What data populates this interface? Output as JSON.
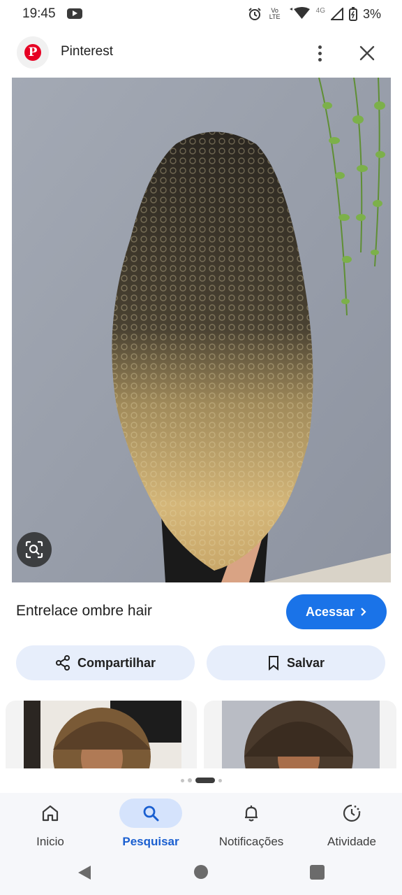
{
  "status_bar": {
    "time": "19:45",
    "network": "4G",
    "volte": "Vo LTE",
    "battery": "3%"
  },
  "header": {
    "app_title": "Pinterest",
    "logo_letter": "P"
  },
  "pin": {
    "title": "Entrelace ombre hair",
    "visit_label": "Acessar",
    "share_label": "Compartilhar",
    "save_label": "Salvar"
  },
  "pager": {
    "count": 4,
    "active_index": 2
  },
  "bottom_nav": {
    "items": [
      {
        "label": "Inicio",
        "icon": "home-icon"
      },
      {
        "label": "Pesquisar",
        "icon": "search-icon",
        "active": true
      },
      {
        "label": "Notificações",
        "icon": "bell-icon"
      },
      {
        "label": "Atividade",
        "icon": "activity-icon"
      }
    ]
  },
  "colors": {
    "accent": "#1a73e8",
    "pill_bg": "#e7eefb",
    "brand": "#e60023"
  }
}
